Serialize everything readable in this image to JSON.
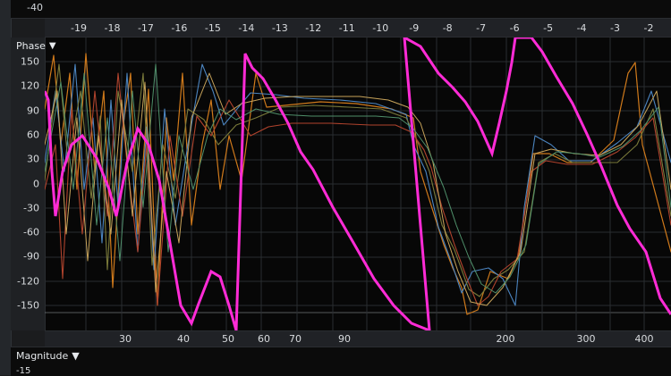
{
  "top_panel": {
    "y_label": "-40"
  },
  "top_ruler": {
    "ticks": [
      "-19",
      "-18",
      "-17",
      "-16",
      "-15",
      "-14",
      "-13",
      "-12",
      "-11",
      "-10",
      "-9",
      "-8",
      "-7",
      "-6",
      "-5",
      "-4",
      "-3",
      "-2"
    ]
  },
  "phase_panel": {
    "title": "Phase",
    "dropdown_icon": "caret-down-icon",
    "y_labels": [
      "150",
      "120",
      "90",
      "60",
      "30",
      "0",
      "-30",
      "-60",
      "-90",
      "-120",
      "-150"
    ],
    "colors": {
      "pink": "#ff2bd6",
      "orange": "#d07a1b",
      "blue": "#4b84bf",
      "olive": "#7a7a3a",
      "red": "#b0432d",
      "tan": "#c7a35a"
    }
  },
  "bottom_ruler": {
    "ticks": [
      "30",
      "40",
      "50",
      "60",
      "70",
      "90",
      "200",
      "300",
      "400"
    ]
  },
  "magnitude_panel": {
    "title": "Magnitude",
    "dropdown_icon": "caret-down-icon",
    "y_label": "-15"
  }
}
